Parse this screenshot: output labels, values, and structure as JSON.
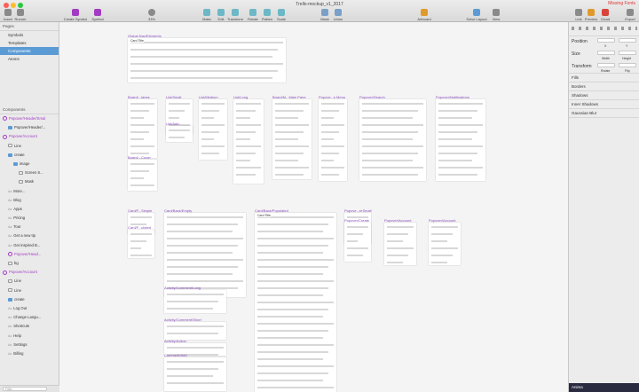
{
  "window": {
    "title": "Trello-mockup_v1_2017",
    "warning": "Missing Fonts"
  },
  "toolbar": {
    "left": [
      "Insert",
      "Runner",
      "Create Symbol",
      "Symbol"
    ],
    "zoom": "33%",
    "center": [
      "Make Grid",
      "Edit",
      "Transform",
      "Rotate",
      "Flatten",
      "Scale",
      "Mask",
      "Union"
    ],
    "artboard": "Artboard",
    "right": [
      "Solve Layout",
      "View",
      "Link",
      "Preview",
      "Cloud",
      "Export"
    ]
  },
  "pages": {
    "header": "Pages",
    "items": [
      "Symbols",
      "Templates",
      "Components",
      "Atoms"
    ],
    "selected": 2
  },
  "layers": {
    "header": "Components",
    "filter_placeholder": "Filter",
    "items": [
      {
        "label": "Popover/Header/Smal",
        "kind": "sym",
        "indent": 0
      },
      {
        "label": "Popover/Header/...",
        "kind": "folder",
        "indent": 1
      },
      {
        "label": "Popover/Account",
        "kind": "sym",
        "indent": 0
      },
      {
        "label": "Line",
        "kind": "shape",
        "indent": 1
      },
      {
        "label": "create",
        "kind": "folder",
        "indent": 1
      },
      {
        "label": "image",
        "kind": "folder",
        "indent": 2
      },
      {
        "label": "Screen S...",
        "kind": "shape",
        "indent": 3
      },
      {
        "label": "Mask",
        "kind": "shape",
        "indent": 3
      },
      {
        "label": "More...",
        "kind": "txt",
        "indent": 1
      },
      {
        "label": "Blog",
        "kind": "txt",
        "indent": 1
      },
      {
        "label": "Apps",
        "kind": "txt",
        "indent": 1
      },
      {
        "label": "Pricing",
        "kind": "txt",
        "indent": 1
      },
      {
        "label": "Tour",
        "kind": "txt",
        "indent": 1
      },
      {
        "label": "Get a new tip",
        "kind": "txt",
        "indent": 1
      },
      {
        "label": "Get inspired B...",
        "kind": "txt",
        "indent": 1
      },
      {
        "label": "Popover/Head...",
        "kind": "sym",
        "indent": 1
      },
      {
        "label": "bg",
        "kind": "shape",
        "indent": 1
      },
      {
        "label": "Popover/Account",
        "kind": "sym",
        "indent": 0
      },
      {
        "label": "Line",
        "kind": "shape",
        "indent": 1
      },
      {
        "label": "Line",
        "kind": "shape",
        "indent": 1
      },
      {
        "label": "create",
        "kind": "folder",
        "indent": 1
      },
      {
        "label": "Log Out",
        "kind": "txt",
        "indent": 1
      },
      {
        "label": "Change Langu...",
        "kind": "txt",
        "indent": 1
      },
      {
        "label": "Shortcuts",
        "kind": "txt",
        "indent": 1
      },
      {
        "label": "Help",
        "kind": "txt",
        "indent": 1
      },
      {
        "label": "Settings",
        "kind": "txt",
        "indent": 1
      },
      {
        "label": "Billing",
        "kind": "txt",
        "indent": 1
      }
    ]
  },
  "inspector": {
    "position": "Position",
    "size": "Size",
    "transform": "Transform",
    "x": "X",
    "y": "Y",
    "width": "Width",
    "height": "Height",
    "rotate": "Rotate",
    "flip": "Flip",
    "sections": [
      "Fills",
      "Borders",
      "Shadows",
      "Inner Shadows",
      "Gaussian Blur"
    ],
    "bottom": "Anima"
  },
  "artboards": [
    {
      "label": "Global Nav/Elements",
      "title": "Card Title"
    },
    {
      "label": "Board/...lanes",
      "title": ""
    },
    {
      "label": "List/Small",
      "title": ""
    },
    {
      "label": "List/Medium",
      "title": ""
    },
    {
      "label": "List/Long",
      "title": ""
    },
    {
      "label": "Board/M...Main Pane",
      "title": ""
    },
    {
      "label": "Popove...s Menu",
      "title": ""
    },
    {
      "label": "Popover/Search",
      "title": ""
    },
    {
      "label": "Popover/Notifications",
      "title": ""
    },
    {
      "label": "Card/F...Simple",
      "title": ""
    },
    {
      "label": "Card/Back/Empty",
      "title": ""
    },
    {
      "label": "Card/Back/Populated",
      "title": "Card Title"
    },
    {
      "label": "Popove...erSmall",
      "title": ""
    },
    {
      "label": "Popover/Create",
      "title": ""
    },
    {
      "label": "Popover/Account",
      "title": ""
    },
    {
      "label": "Popover/Account",
      "title": ""
    },
    {
      "label": "Activity/Comment/Long",
      "title": ""
    },
    {
      "label": "Activity/Comment/Short",
      "title": ""
    },
    {
      "label": "Activity/Action",
      "title": ""
    },
    {
      "label": "Comment/Add",
      "title": ""
    },
    {
      "label": "Card/F...ulated",
      "title": ""
    },
    {
      "label": "List/Add",
      "title": ""
    },
    {
      "label": "Board/...Cover",
      "title": ""
    }
  ],
  "colors": {
    "accent": "#5b9bd5",
    "symbol": "#a23bc3",
    "label": "#8a4dbf",
    "nav": "#3b6cb5"
  }
}
